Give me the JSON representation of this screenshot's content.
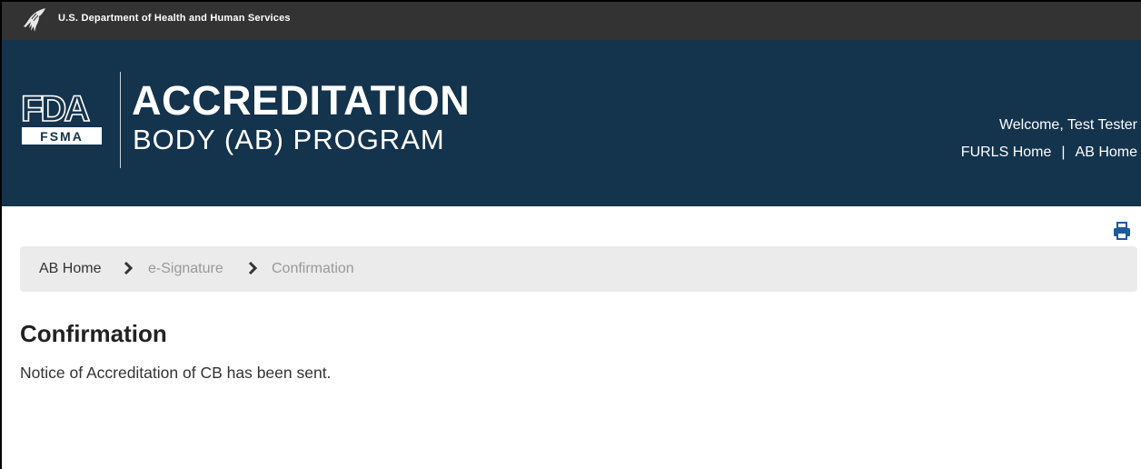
{
  "agency_bar": {
    "text": "U.S. Department of Health and Human Services"
  },
  "banner": {
    "logo": {
      "icon": "fda-fsma-logo",
      "primary": "FDA",
      "secondary": "FSMA"
    },
    "title_line1": "ACCREDITATION",
    "title_line2": "BODY (AB) PROGRAM",
    "welcome": "Welcome, Test Tester",
    "links": {
      "furls_home": "FURLS Home",
      "separator": "|",
      "ab_home": "AB Home"
    }
  },
  "toolbar": {
    "print_icon": "print-icon"
  },
  "breadcrumb": {
    "items": [
      "AB Home",
      "e-Signature",
      "Confirmation"
    ],
    "separator_icon": "chevron-right-icon"
  },
  "main": {
    "title": "Confirmation",
    "message": "Notice of Accreditation of CB has been sent."
  },
  "colors": {
    "agency_bar": "#333333",
    "banner": "#14334d",
    "breadcrumb_bg": "#ebebeb",
    "muted_text": "#999999",
    "accent": "#1e5a9c"
  }
}
